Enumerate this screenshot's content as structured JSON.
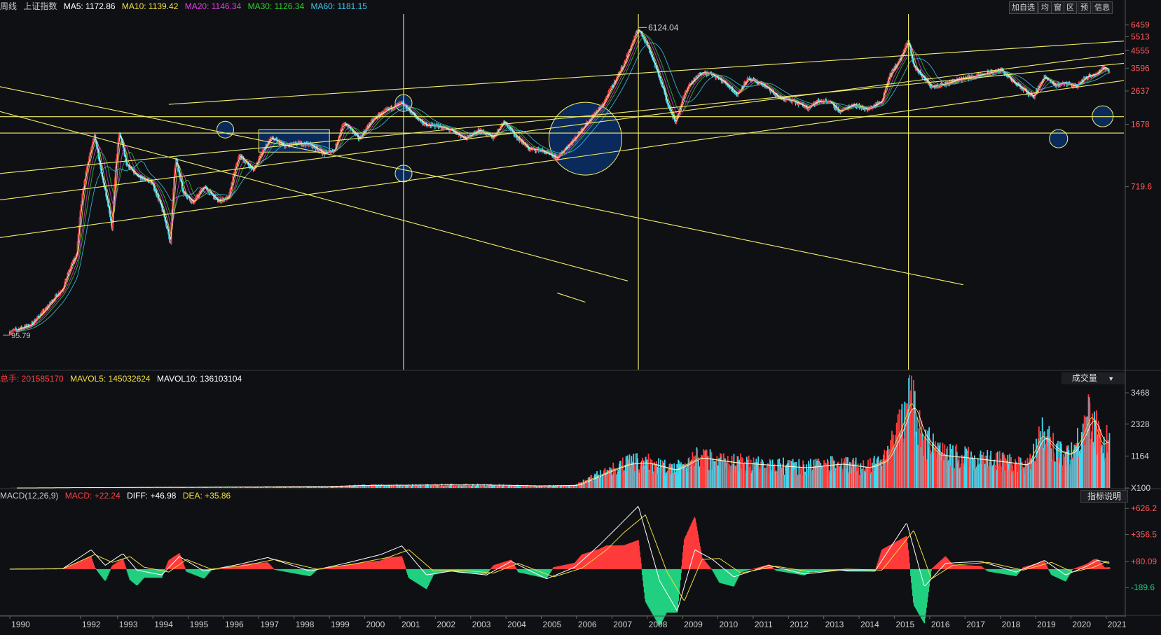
{
  "header": {
    "period": "周线",
    "index_name": "上证指数",
    "ma": [
      {
        "label": "MA5: 1172.86",
        "color": "#ffffff"
      },
      {
        "label": "MA10: 1139.42",
        "color": "#f0e040"
      },
      {
        "label": "MA20: 1146.34",
        "color": "#e040e0"
      },
      {
        "label": "MA30: 1126.34",
        "color": "#30d030"
      },
      {
        "label": "MA60: 1181.15",
        "color": "#40c8f0"
      }
    ]
  },
  "toolbar": {
    "buttons": [
      "加自选",
      "均",
      "窗",
      "区",
      "预",
      "信息"
    ]
  },
  "volume_header": {
    "total": {
      "label": "总手: 201585170",
      "color": "#ff4040"
    },
    "mavol5": {
      "label": "MAVOL5: 145032624",
      "color": "#f0e040"
    },
    "mavol10": {
      "label": "MAVOL10: 136103104",
      "color": "#ffffff"
    }
  },
  "volume_selector": "成交量",
  "macd_header": {
    "name": {
      "label": "MACD(12,26,9)",
      "color": "#c9c9c9"
    },
    "macd": {
      "label": "MACD: +22.24",
      "color": "#ff4040"
    },
    "diff": {
      "label": "DIFF: +46.98",
      "color": "#ffffff"
    },
    "dea": {
      "label": "DEA: +35.86",
      "color": "#f0e040"
    }
  },
  "indicator_button": "指标说明",
  "colors": {
    "up": "#ff3b3b",
    "down": "#3fd8f0",
    "line": "#f5f06a",
    "axis": "#5a5a5a",
    "circle_fill": "#0b2a5c"
  },
  "chart_data": [
    {
      "type": "line",
      "title": "上证指数 周线",
      "price_axis_ticks": [
        "6459",
        "5513",
        "4555",
        "3596",
        "2637",
        "1678",
        "719.6"
      ],
      "ylim": [
        95.79,
        6459
      ],
      "annotations": [
        {
          "text": "6124.04",
          "x": 2007.8,
          "y": 6124.04
        },
        {
          "text": "95.79",
          "x": 1990.0,
          "y": 95.79
        }
      ],
      "x_ticks": [
        "1990",
        "1992",
        "1993",
        "1994",
        "1995",
        "1996",
        "1997",
        "1998",
        "1999",
        "2000",
        "2001",
        "2002",
        "2003",
        "2004",
        "2005",
        "2006",
        "2007",
        "2008",
        "2009",
        "2010",
        "2011",
        "2012",
        "2013",
        "2014",
        "2015",
        "2016",
        "2017",
        "2018",
        "2019",
        "2020",
        "2021"
      ],
      "series": [
        {
          "name": "上证指数",
          "x": [
            1990.0,
            1990.6,
            1991.0,
            1991.5,
            1991.9,
            1992.4,
            1992.6,
            1992.9,
            1993.1,
            1993.3,
            1993.6,
            1994.0,
            1994.3,
            1994.55,
            1994.7,
            1994.9,
            1995.2,
            1995.5,
            1995.9,
            1996.2,
            1996.5,
            1996.9,
            1997.1,
            1997.4,
            1997.8,
            1998.2,
            1998.5,
            1998.9,
            1999.2,
            1999.4,
            1999.5,
            1999.9,
            2000.3,
            2000.7,
            2001.1,
            2001.5,
            2001.8,
            2002.1,
            2002.5,
            2002.9,
            2003.3,
            2003.7,
            2004.0,
            2004.3,
            2004.7,
            2005.0,
            2005.5,
            2006.0,
            2006.4,
            2006.8,
            2007.1,
            2007.4,
            2007.6,
            2007.8,
            2008.0,
            2008.3,
            2008.6,
            2008.85,
            2009.2,
            2009.6,
            2009.9,
            2010.3,
            2010.6,
            2010.9,
            2011.3,
            2011.8,
            2012.2,
            2012.6,
            2012.9,
            2013.2,
            2013.5,
            2013.9,
            2014.3,
            2014.7,
            2014.9,
            2015.2,
            2015.45,
            2015.6,
            2015.8,
            2016.1,
            2016.5,
            2016.9,
            2017.3,
            2017.8,
            2018.1,
            2018.4,
            2018.8,
            2019.0,
            2019.3,
            2019.6,
            2019.9,
            2020.2,
            2020.5,
            2020.8,
            2021.0,
            2021.15
          ],
          "y": [
            100,
            110,
            135,
            180,
            290,
            1420,
            830,
            400,
            1500,
            980,
            830,
            770,
            540,
            330,
            1050,
            670,
            580,
            720,
            590,
            620,
            1100,
            900,
            1100,
            1400,
            1250,
            1300,
            1280,
            1130,
            1180,
            1600,
            1700,
            1370,
            1800,
            2050,
            2240,
            1850,
            1650,
            1650,
            1550,
            1380,
            1550,
            1400,
            1750,
            1450,
            1200,
            1190,
            1060,
            1380,
            1750,
            2200,
            2900,
            3800,
            4900,
            6124,
            5200,
            3600,
            2300,
            1710,
            2800,
            3400,
            3300,
            2900,
            2500,
            3100,
            2900,
            2400,
            2300,
            2100,
            2300,
            2300,
            1990,
            2200,
            2050,
            2300,
            3200,
            4000,
            5178,
            3700,
            3300,
            2800,
            2900,
            3100,
            3200,
            3400,
            3500,
            3000,
            2600,
            2440,
            3200,
            2850,
            2950,
            2800,
            3200,
            3350,
            3650,
            3450
          ]
        }
      ]
    },
    {
      "type": "bar",
      "title": "成交量",
      "volume_axis_ticks": [
        "3468",
        "2328",
        "1164",
        "X100"
      ],
      "series": [
        {
          "name": "成交量",
          "x": [
            1990,
            1995,
            1999,
            2000,
            2003,
            2005,
            2006,
            2007,
            2007.5,
            2008,
            2008.8,
            2009.5,
            2010.5,
            2011.5,
            2012.5,
            2013.5,
            2014.3,
            2014.8,
            2015.2,
            2015.5,
            2015.8,
            2016.3,
            2017,
            2018,
            2018.8,
            2019.2,
            2019.6,
            2020.0,
            2020.3,
            2020.6,
            2020.9,
            2021.1
          ],
          "y": [
            0,
            30,
            60,
            100,
            130,
            80,
            100,
            700,
            950,
            1000,
            700,
            1200,
            1000,
            900,
            800,
            950,
            800,
            1100,
            2300,
            3468,
            2100,
            1300,
            1200,
            1050,
            900,
            2100,
            1500,
            1300,
            1900,
            2900,
            1700,
            1850
          ]
        }
      ]
    },
    {
      "type": "area",
      "title": "MACD(12,26,9)",
      "macd_axis_ticks": [
        "+626.2",
        "+356.5",
        "+80.09",
        "-189.6"
      ],
      "series": [
        {
          "name": "DIFF",
          "x": [
            1990,
            1991.5,
            1992.3,
            1992.7,
            1993.2,
            1993.6,
            1994.3,
            1994.8,
            1995.5,
            1996.5,
            1997.3,
            1998.5,
            1999.5,
            2000.5,
            2001.1,
            2001.8,
            2002.5,
            2003.5,
            2004.2,
            2005.2,
            2006.0,
            2006.7,
            2007.2,
            2007.8,
            2008.4,
            2008.9,
            2009.4,
            2009.9,
            2010.5,
            2011.5,
            2012.5,
            2013.5,
            2014.5,
            2015.4,
            2015.9,
            2016.5,
            2017.5,
            2018.5,
            2019.3,
            2019.9,
            2020.5,
            2020.8,
            2021.15
          ],
          "y": [
            0,
            5,
            200,
            40,
            160,
            -10,
            -60,
            130,
            -20,
            50,
            120,
            -20,
            60,
            150,
            240,
            -60,
            -20,
            -60,
            80,
            -100,
            20,
            250,
            430,
            650,
            -120,
            -430,
            200,
            100,
            -80,
            40,
            -50,
            -10,
            -20,
            480,
            -180,
            60,
            80,
            -30,
            90,
            -60,
            30,
            90,
            70
          ]
        },
        {
          "name": "DEA",
          "x": [
            1990,
            1991.5,
            1992.4,
            1992.9,
            1993.4,
            1993.8,
            1994.5,
            1995.0,
            1995.7,
            1996.7,
            1997.5,
            1998.7,
            1999.7,
            2000.7,
            2001.3,
            2002.0,
            2002.7,
            2003.7,
            2004.4,
            2005.4,
            2006.2,
            2006.9,
            2007.4,
            2008.0,
            2008.6,
            2009.1,
            2009.6,
            2010.1,
            2010.7,
            2011.7,
            2012.7,
            2013.7,
            2014.7,
            2015.6,
            2016.1,
            2016.7,
            2017.7,
            2018.7,
            2019.5,
            2020.1,
            2020.7,
            2021.0,
            2021.15
          ],
          "y": [
            0,
            3,
            150,
            70,
            130,
            20,
            -30,
            100,
            0,
            40,
            100,
            0,
            50,
            120,
            200,
            -20,
            -10,
            -40,
            60,
            -80,
            10,
            200,
            380,
            560,
            -20,
            -330,
            100,
            110,
            -40,
            30,
            -30,
            0,
            -10,
            400,
            -100,
            40,
            70,
            -10,
            70,
            -30,
            20,
            70,
            60
          ]
        }
      ],
      "histogram_note": "红柱 = MACD>0, 绿柱 = MACD<0"
    }
  ]
}
